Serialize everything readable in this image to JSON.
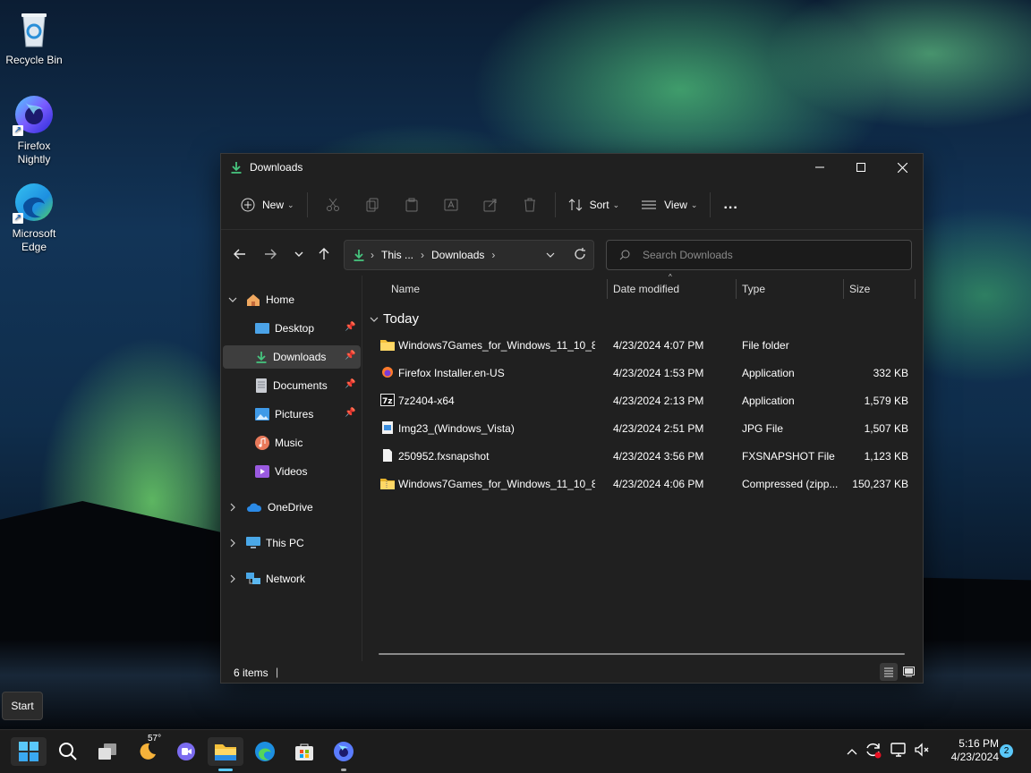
{
  "desktop": {
    "icons": [
      {
        "label_line1": "Recycle Bin",
        "label_line2": ""
      },
      {
        "label_line1": "Firefox",
        "label_line2": "Nightly"
      },
      {
        "label_line1": "Microsoft",
        "label_line2": "Edge"
      }
    ]
  },
  "window": {
    "title": "Downloads",
    "toolbar": {
      "new_label": "New",
      "sort_label": "Sort",
      "view_label": "View",
      "more_label": "..."
    },
    "address": {
      "segment_1": "This ...",
      "segment_2": "Downloads"
    },
    "search": {
      "placeholder": "Search Downloads"
    },
    "sidebar": {
      "home": "Home",
      "quick": [
        "Desktop",
        "Downloads",
        "Documents",
        "Pictures",
        "Music",
        "Videos"
      ],
      "onedrive": "OneDrive",
      "thispc": "This PC",
      "network": "Network"
    },
    "columns": {
      "name": "Name",
      "date": "Date modified",
      "type": "Type",
      "size": "Size"
    },
    "group_label": "Today",
    "files": [
      {
        "name": "Windows7Games_for_Windows_11_10_8",
        "date": "4/23/2024 4:07 PM",
        "type": "File folder",
        "size": "",
        "icon": "folder-icon"
      },
      {
        "name": "Firefox Installer.en-US",
        "date": "4/23/2024 1:53 PM",
        "type": "Application",
        "size": "332 KB",
        "icon": "firefox-installer-icon"
      },
      {
        "name": "7z2404-x64",
        "date": "4/23/2024 2:13 PM",
        "type": "Application",
        "size": "1,579 KB",
        "icon": "7zip-icon"
      },
      {
        "name": "Img23_(Windows_Vista)",
        "date": "4/23/2024 2:51 PM",
        "type": "JPG File",
        "size": "1,507 KB",
        "icon": "image-file-icon"
      },
      {
        "name": "250952.fxsnapshot",
        "date": "4/23/2024 3:56 PM",
        "type": "FXSNAPSHOT File",
        "size": "1,123 KB",
        "icon": "blank-file-icon"
      },
      {
        "name": "Windows7Games_for_Windows_11_10_8",
        "date": "4/23/2024 4:06 PM",
        "type": "Compressed (zipp...",
        "size": "150,237 KB",
        "icon": "zip-folder-icon"
      }
    ],
    "status": {
      "items": "6 items"
    }
  },
  "tooltip": {
    "text": "Start"
  },
  "taskbar": {
    "weather_temp": "57°",
    "clock_time": "5:16 PM",
    "clock_date": "4/23/2024",
    "notification_count": "2"
  }
}
